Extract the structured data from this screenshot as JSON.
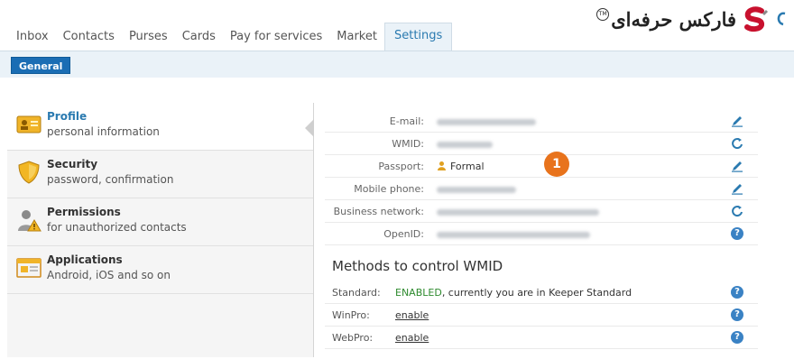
{
  "nav": {
    "tabs": [
      "Inbox",
      "Contacts",
      "Purses",
      "Cards",
      "Pay for services",
      "Market",
      "Settings"
    ],
    "active_tab": "Settings"
  },
  "logo": {
    "text": "فارکس حرفه‌ای",
    "tm": "TM"
  },
  "subbar": {
    "general_label": "General"
  },
  "menu": {
    "items": [
      {
        "title": "Profile",
        "subtitle": "personal information",
        "icon": "profile-card-icon"
      },
      {
        "title": "Security",
        "subtitle": "password, confirmation",
        "icon": "shield-icon"
      },
      {
        "title": "Permissions",
        "subtitle": "for unauthorized contacts",
        "icon": "person-warning-icon"
      },
      {
        "title": "Applications",
        "subtitle": "Android, iOS and so on",
        "icon": "application-window-icon"
      }
    ]
  },
  "profile": {
    "email_label": "E-mail:",
    "wmid_label": "WMID:",
    "passport_label": "Passport:",
    "passport_value": "Formal",
    "mobile_label": "Mobile phone:",
    "business_label": "Business network:",
    "openid_label": "OpenID:"
  },
  "methods": {
    "heading": "Methods to control WMID",
    "standard_label": "Standard:",
    "standard_status": "ENABLED",
    "standard_text": ", currently you are in Keeper Standard",
    "winpro_label": "WinPro:",
    "winpro_link": "enable",
    "webpro_label": "WebPro:",
    "webpro_link": "enable"
  },
  "annotation": {
    "badge": "1"
  },
  "colors": {
    "accent": "#1a6db4",
    "badge": "#e8731c",
    "enabled": "#2e8a2e"
  }
}
